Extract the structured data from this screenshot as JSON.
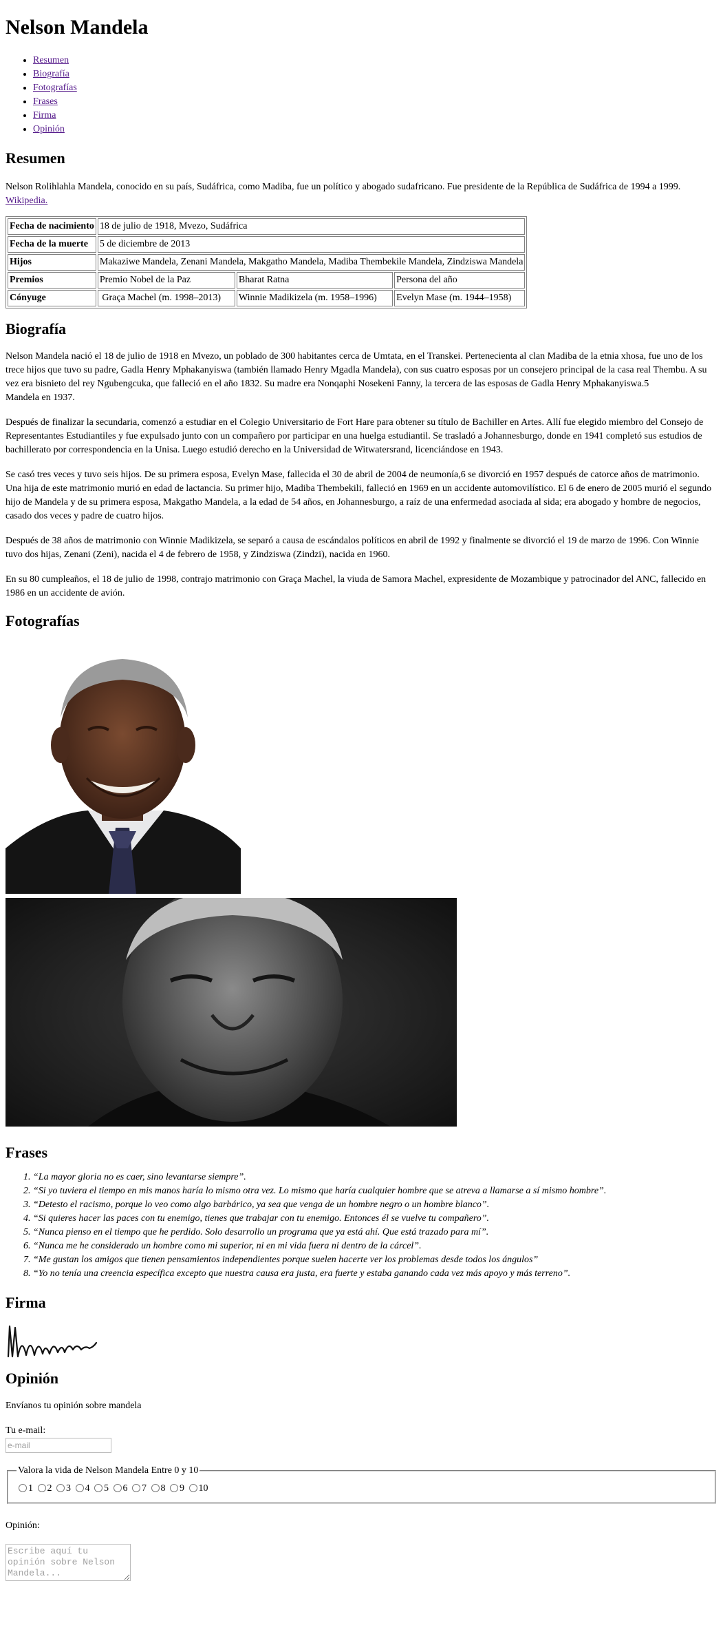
{
  "title": "Nelson Mandela",
  "nav": [
    "Resumen",
    "Biografía",
    "Fotografías",
    "Frases",
    "Firma",
    "Opinión"
  ],
  "resumen": {
    "heading": "Resumen",
    "text": "Nelson Rolihlahla Mandela, conocido en su país, Sudáfrica, como Madiba, fue un político y abogado sudafricano. Fue presidente de la República de Sudáfrica de 1994 a 1999.",
    "link": "Wikipedia."
  },
  "table": {
    "rows": [
      {
        "label": "Fecha de nacimiento",
        "values": [
          "18 de julio de 1918, Mvezo, Sudáfrica"
        ]
      },
      {
        "label": "Fecha de la muerte",
        "values": [
          "5 de diciembre de 2013"
        ]
      },
      {
        "label": "Hijos",
        "values": [
          "Makaziwe Mandela, Zenani Mandela, Makgatho Mandela, Madiba Thembekile Mandela, Zindziswa Mandela"
        ]
      },
      {
        "label": "Premios",
        "values": [
          "Premio Nobel de la Paz",
          "Bharat Ratna",
          "Persona del año"
        ]
      },
      {
        "label": "Cónyuge",
        "values": [
          " Graça Machel (m. 1998–2013)",
          "Winnie Madikizela (m. 1958–1996)",
          "Evelyn Mase (m. 1944–1958)"
        ]
      }
    ]
  },
  "biografia": {
    "heading": "Biografía",
    "paragraphs": [
      "Nelson Mandela nació el 18 de julio de 1918 en Mvezo, un poblado de 300 habitantes cerca de Umtata, en el Transkei. Pertenecienta al clan Madiba de la etnia xhosa, fue uno de los trece hijos que tuvo su padre, Gadla Henry Mphakanyiswa (también llamado Henry Mgadla Mandela), con sus cuatro esposas por un consejero principal de la casa real Thembu. A su vez era bisnieto del rey Ngubengcuka, que falleció en el año 1832. Su madre era Nonqaphi Nosekeni Fanny, la tercera de las esposas de Gadla Henry Mphakanyiswa.5\nMandela en 1937.",
      "Después de finalizar la secundaria, comenzó a estudiar en el Colegio Universitario de Fort Hare para obtener su título de Bachiller en Artes. Allí fue elegido miembro del Consejo de Representantes Estudiantiles y fue expulsado junto con un compañero por participar en una huelga estudiantil. Se trasladó a Johannesburgo, donde en 1941 completó sus estudios de bachillerato por correspondencia en la Unisa. Luego estudió derecho en la Universidad de Witwatersrand, licenciándose en 1943.",
      "Se casó tres veces y tuvo seis hijos. De su primera esposa, Evelyn Mase, fallecida el 30 de abril de 2004 de neumonía,6 se divorció en 1957 después de catorce años de matrimonio. Una hija de este matrimonio murió en edad de lactancia. Su primer hijo, Madiba Thembekili, falleció en 1969 en un accidente automovilístico. El 6 de enero de 2005 murió el segundo hijo de Mandela y de su primera esposa, Makgatho Mandela, a la edad de 54 años, en Johannesburgo, a raíz de una enfermedad asociada al sida; era abogado y hombre de negocios, casado dos veces y padre de cuatro hijos.",
      "Después de 38 años de matrimonio con Winnie Madikizela, se separó a causa de escándalos políticos en abril de 1992 y finalmente se divorció el 19 de marzo de 1996. Con Winnie tuvo dos hijas, Zenani (Zeni), nacida el 4 de febrero de 1958, y Zindziswa (Zindzi), nacida en 1960.",
      "En su 80 cumpleaños, el 18 de julio de 1998, contrajo matrimonio con Graça Machel, la viuda de Samora Machel, expresidente de Mozambique y patrocinador del ANC, fallecido en 1986 en un accidente de avión."
    ]
  },
  "fotografias": {
    "heading": "Fotografías"
  },
  "frases": {
    "heading": "Frases",
    "items": [
      "“La mayor gloria no es caer, sino levantarse siempre”.",
      "“Si yo tuviera el tiempo en mis manos haría lo mismo otra vez. Lo mismo que haría cualquier hombre que se atreva a llamarse a sí mismo hombre”.",
      "“Detesto el racismo, porque lo veo como algo barbárico, ya sea que venga de un hombre negro o un hombre blanco”.",
      "“Si quieres hacer las paces con tu enemigo, tienes que trabajar con tu enemigo. Entonces él se vuelve tu compañero”.",
      "“Nunca pienso en el tiempo que he perdido. Solo desarrollo un programa que ya está ahí. Que está trazado para mí”.",
      "“Nunca me he considerado un hombre como mi superior, ni en mi vida fuera ni dentro de la cárcel”.",
      "“Me gustan los amigos que tienen pensamientos independientes porque suelen hacerte ver los problemas desde todos los ángulos”",
      "“Yo no tenía una creencia específica excepto que nuestra causa era justa, era fuerte y estaba ganando cada vez más apoyo y más terreno”."
    ]
  },
  "firma": {
    "heading": "Firma",
    "signature_text": "N Mandela"
  },
  "opinion": {
    "heading": "Opinión",
    "intro": "Envíanos tu opinión sobre mandela",
    "email_label": "Tu e-mail:",
    "email_placeholder": "e-mail",
    "rating_legend": "Valora la vida de Nelson Mandela Entre 0 y 10",
    "rating_options": [
      "1",
      "2",
      "3",
      "4",
      "5",
      "6",
      "7",
      "8",
      "9",
      "10"
    ],
    "comment_label": "Opinión:",
    "comment_placeholder": "Escribe aquí tu opinión sobre Nelson Mandela..."
  }
}
